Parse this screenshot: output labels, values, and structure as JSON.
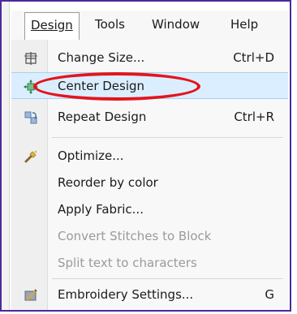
{
  "menubar": {
    "items": [
      {
        "label": "Design",
        "active": true
      },
      {
        "label": "Tools",
        "active": false
      },
      {
        "label": "Window",
        "active": false
      },
      {
        "label": "Help",
        "active": false
      }
    ]
  },
  "menu": {
    "items": [
      {
        "label": "Change Size...",
        "shortcut": "Ctrl+D",
        "icon": "change-size-icon",
        "enabled": true
      },
      {
        "label": "Center Design",
        "shortcut": "",
        "icon": "center-design-icon",
        "enabled": true,
        "highlighted": true
      },
      {
        "label": "Repeat Design",
        "shortcut": "Ctrl+R",
        "icon": "repeat-design-icon",
        "enabled": true
      },
      {
        "label": "Optimize...",
        "shortcut": "",
        "icon": "optimize-icon",
        "enabled": true
      },
      {
        "label": "Reorder by color",
        "shortcut": "",
        "icon": "",
        "enabled": true
      },
      {
        "label": "Apply Fabric...",
        "shortcut": "",
        "icon": "",
        "enabled": true
      },
      {
        "label": "Convert Stitches to Block",
        "shortcut": "",
        "icon": "",
        "enabled": false
      },
      {
        "label": "Split text to characters",
        "shortcut": "",
        "icon": "",
        "enabled": false
      },
      {
        "label": "Embroidery Settings...",
        "shortcut": "G",
        "icon": "embroidery-settings-icon",
        "enabled": true
      }
    ]
  },
  "colors": {
    "frame": "#4a2a9c",
    "highlight": "#dbeeff",
    "callout": "#e3151d"
  }
}
